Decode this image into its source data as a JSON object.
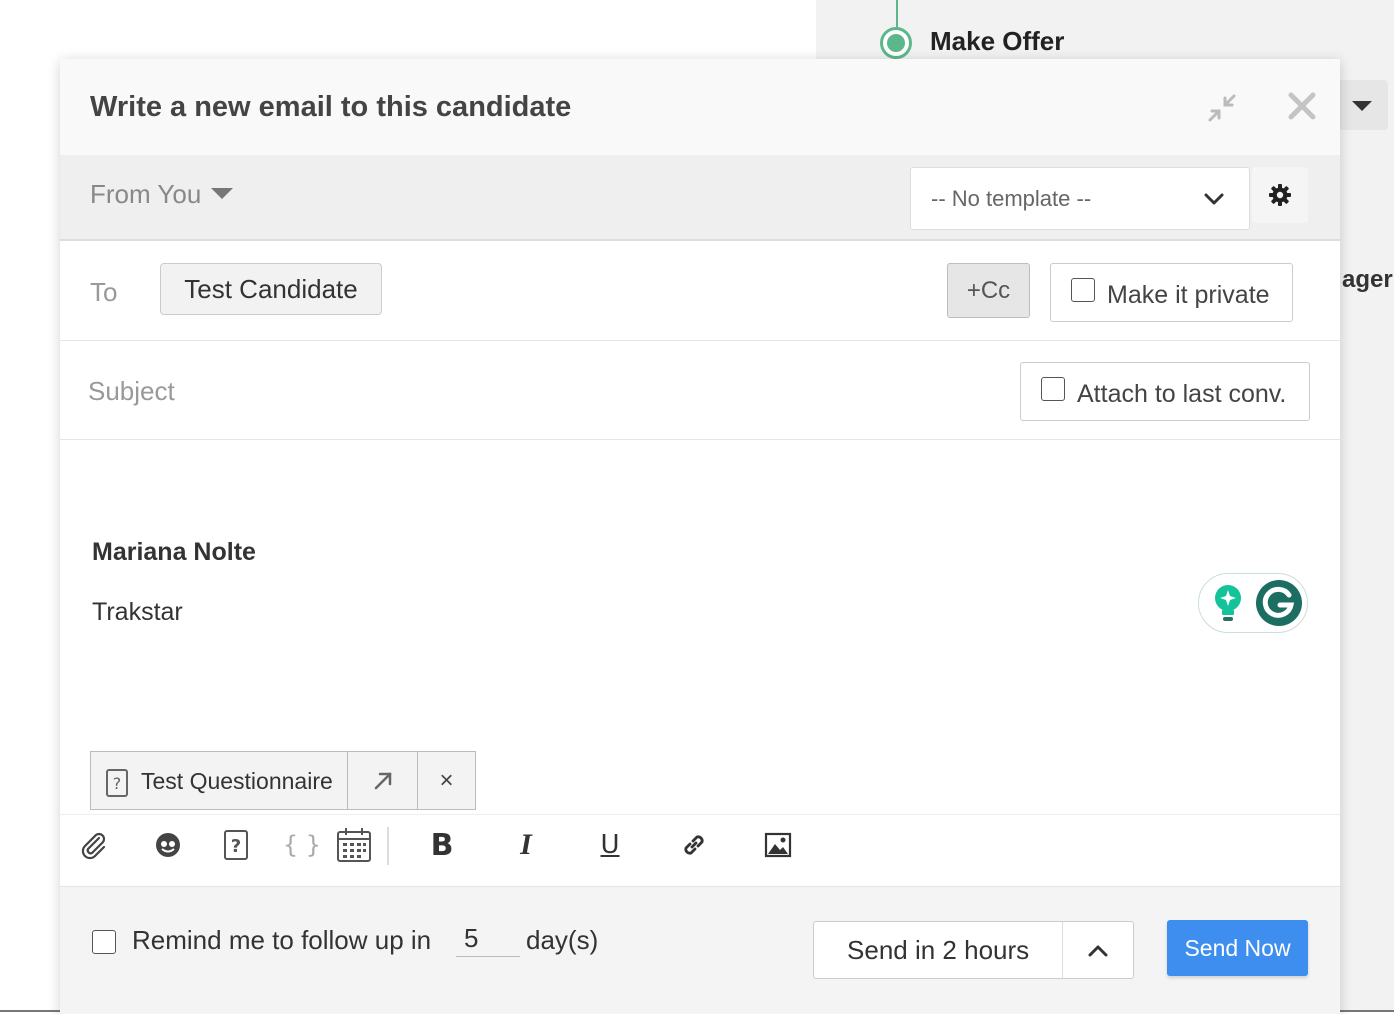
{
  "background": {
    "stage_label": "Make Offer",
    "side_label": "ager"
  },
  "modal": {
    "title": "Write a new email to this candidate",
    "from_label": "From You",
    "template": {
      "selected": "-- No template --"
    },
    "to_label": "To",
    "recipient": "Test Candidate",
    "cc_label": "+Cc",
    "private_label": "Make it private",
    "subject_placeholder": "Subject",
    "attach_conv_label": "Attach to last conv.",
    "signature": {
      "name": "Mariana Nolte",
      "company": "Trakstar"
    },
    "attachment": {
      "name": "Test Questionnaire",
      "remove": "×"
    },
    "toolbar": {
      "bold": "B",
      "italic": "I",
      "underline": "U",
      "variables": "{ }"
    },
    "footer": {
      "remind_before": "Remind me to follow up in",
      "remind_days": "5",
      "remind_after": "day(s)",
      "send_later": "Send in 2 hours",
      "send_now": "Send Now"
    }
  },
  "colors": {
    "accent_blue": "#3d8eef",
    "stage_green": "#5cb88a",
    "grammarly_green": "#15c39a"
  },
  "icons": [
    "minimize-icon",
    "close-icon",
    "chevron-down-icon",
    "gear-icon",
    "questionnaire-icon",
    "open-external-icon",
    "paperclip-icon",
    "emoji-icon",
    "calendar-icon",
    "link-icon",
    "image-icon",
    "chevron-up-icon",
    "bulb-icon",
    "grammarly-icon"
  ]
}
